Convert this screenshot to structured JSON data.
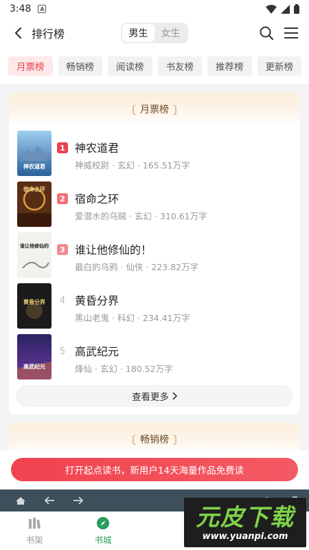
{
  "status_bar": {
    "time": "3:48",
    "notification_glyph": "A"
  },
  "header": {
    "title": "排行榜",
    "gender_options": [
      "男生",
      "女生"
    ],
    "gender_selected": "男生"
  },
  "tabs": [
    {
      "label": "月票榜",
      "active": true
    },
    {
      "label": "畅销榜",
      "active": false
    },
    {
      "label": "阅读榜",
      "active": false
    },
    {
      "label": "书友榜",
      "active": false
    },
    {
      "label": "推荐榜",
      "active": false
    },
    {
      "label": "更新榜",
      "active": false
    }
  ],
  "ranking_card": {
    "title": "月票榜",
    "books": [
      {
        "rank": "1",
        "title": "神农道君",
        "author": "神威校尉",
        "genre": "玄幻",
        "words": "165.51万字",
        "cover_text": "神农道君"
      },
      {
        "rank": "2",
        "title": "宿命之环",
        "author": "爱潜水的乌贼",
        "genre": "玄幻",
        "words": "310.61万字",
        "cover_text": "宿命之环"
      },
      {
        "rank": "3",
        "title": "谁让他修仙的！",
        "author": "最白的乌鸦",
        "genre": "仙侠",
        "words": "223.82万字",
        "cover_text": "谁让他修仙的"
      },
      {
        "rank": "4",
        "title": "黄昏分界",
        "author": "黑山老鬼",
        "genre": "科幻",
        "words": "234.41万字",
        "cover_text": "黄昏分界"
      },
      {
        "rank": "5",
        "title": "高武纪元",
        "author": "烽仙",
        "genre": "玄幻",
        "words": "180.52万字",
        "cover_text": "高武纪元"
      }
    ],
    "more_label": "查看更多"
  },
  "second_card": {
    "title": "畅销榜"
  },
  "banner": {
    "text": "打开起点读书，新用户14天海量作品免费读"
  },
  "bottom_nav": [
    {
      "label": "书架",
      "icon": "bookshelf-icon",
      "active": false
    },
    {
      "label": "书城",
      "icon": "compass-icon",
      "active": true
    }
  ],
  "watermark": {
    "logo": "元皮下载",
    "url": "www.yuanpi.com"
  },
  "colors": {
    "accent": "#e8434f",
    "nav_active": "#2a9d5c",
    "browser_bar": "#3d4f5a"
  }
}
